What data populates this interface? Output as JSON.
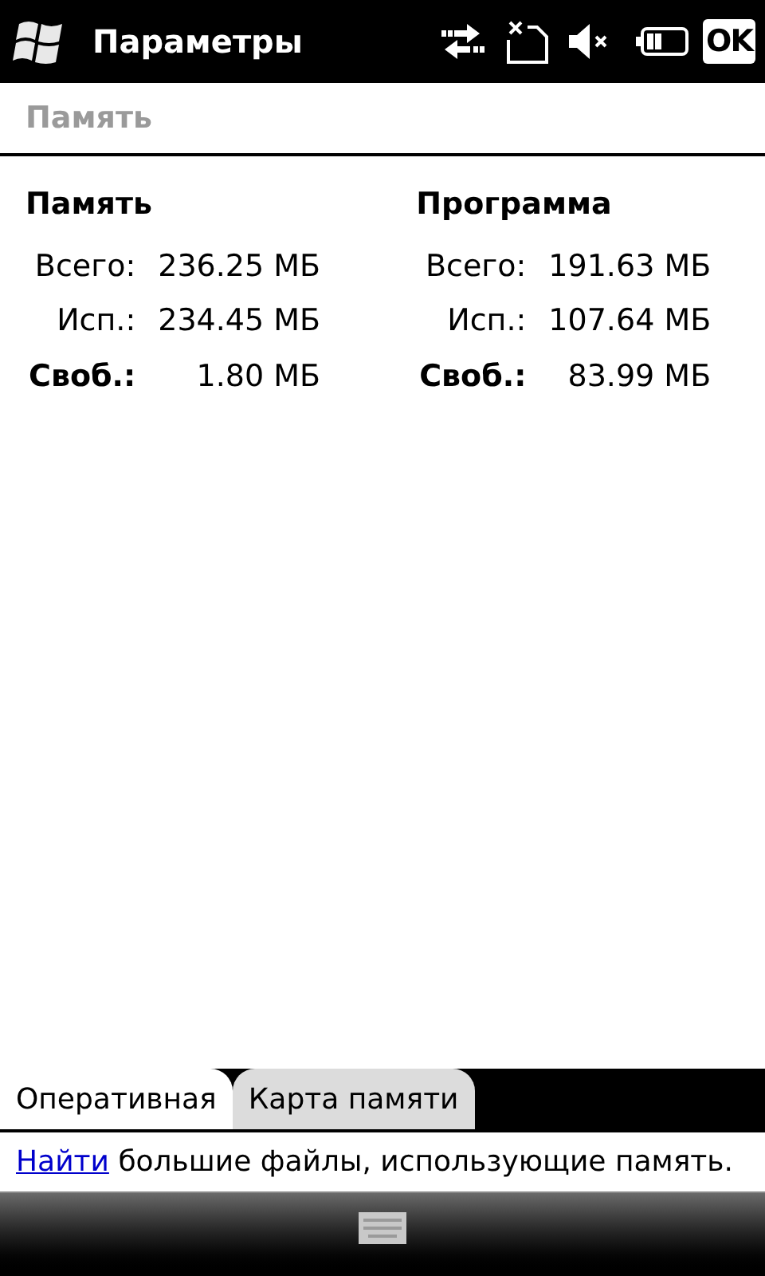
{
  "title_bar": {
    "title": "Параметры",
    "ok_button": "OK"
  },
  "header": {
    "title": "Память"
  },
  "columns": [
    {
      "heading": "Память",
      "rows": [
        {
          "label": "Всего:",
          "value": "236.25 МБ",
          "bold": false
        },
        {
          "label": "Исп.:",
          "value": "234.45 МБ",
          "bold": false
        },
        {
          "label": "Своб.:",
          "value": "1.80 МБ",
          "bold": true
        }
      ]
    },
    {
      "heading": "Программа",
      "rows": [
        {
          "label": "Всего:",
          "value": "191.63 МБ",
          "bold": false
        },
        {
          "label": "Исп.:",
          "value": "107.64 МБ",
          "bold": false
        },
        {
          "label": "Своб.:",
          "value": "83.99 МБ",
          "bold": true
        }
      ]
    }
  ],
  "tabs": [
    {
      "label": "Оперативная",
      "selected": true
    },
    {
      "label": "Карта памяти",
      "selected": false
    }
  ],
  "footer": {
    "link": "Найти",
    "text": "большие файлы, использующие память."
  }
}
